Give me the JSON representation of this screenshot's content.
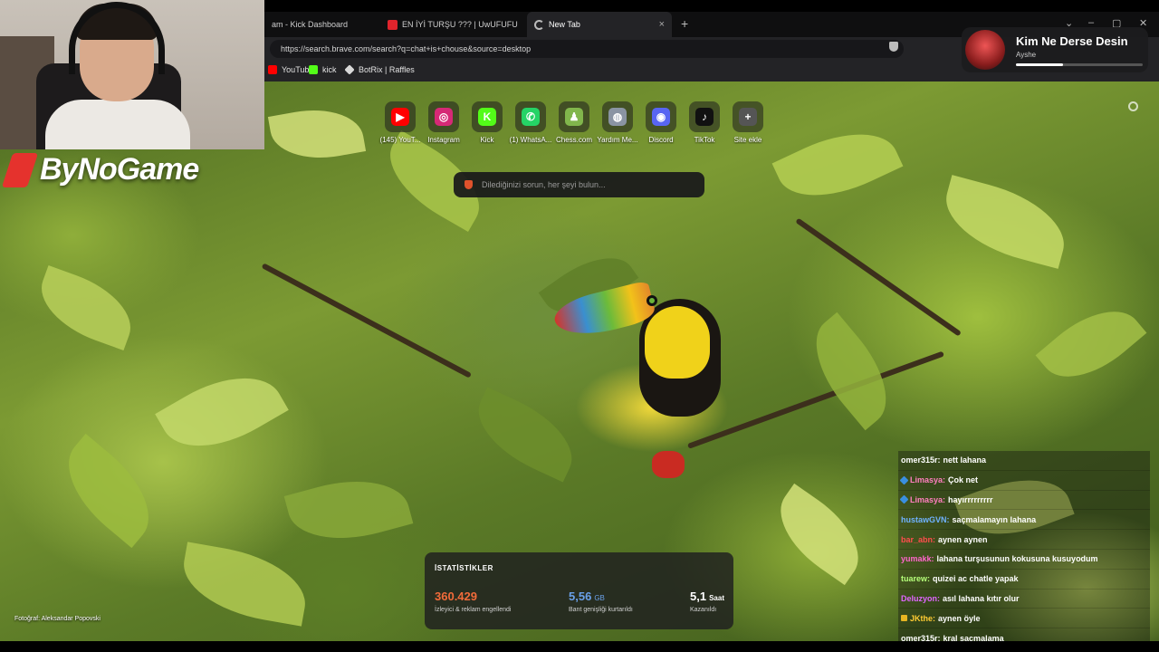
{
  "tabs": [
    {
      "label": "am - Kick Dashboard",
      "favicon_color": "#53fc18"
    },
    {
      "label": "EN İYİ TURŞU ??? | UwUFUFU",
      "favicon_color": "#e0242c"
    },
    {
      "label": "New Tab",
      "favicon_color": "#bbbbbb"
    }
  ],
  "tab_close_glyph": "×",
  "tab_add_glyph": "+",
  "address": {
    "url": "https://search.brave.com/search?q=chat+is+chouse&source=desktop"
  },
  "bookmarks": [
    {
      "label": "YouTube",
      "icon": "youtube-icon",
      "color": "#ff0000"
    },
    {
      "label": "kick",
      "icon": "kick-icon",
      "color": "#53fc18"
    },
    {
      "label": "BotRix | Raffles",
      "icon": "botrix-icon",
      "color": "#d8d8d8"
    }
  ],
  "logo": {
    "text": "ByNoGame"
  },
  "shortcuts": [
    {
      "label": "(145) YouT...",
      "icon": "youtube-icon",
      "color": "#ff0000",
      "glyph": "▶"
    },
    {
      "label": "Instagram",
      "icon": "instagram-icon",
      "color": "#d62976",
      "glyph": "◎"
    },
    {
      "label": "Kick",
      "icon": "kick-icon",
      "color": "#53fc18",
      "glyph": "K"
    },
    {
      "label": "(1) WhatsA...",
      "icon": "whatsapp-icon",
      "color": "#25d366",
      "glyph": "✆"
    },
    {
      "label": "Chess.com",
      "icon": "chess-icon",
      "color": "#81b64c",
      "glyph": "♟"
    },
    {
      "label": "Yardım Me...",
      "icon": "globe-icon",
      "color": "#8a94a3",
      "glyph": "◍"
    },
    {
      "label": "Discord",
      "icon": "discord-icon",
      "color": "#5865f2",
      "glyph": "◉"
    },
    {
      "label": "TikTok",
      "icon": "tiktok-icon",
      "color": "#111111",
      "glyph": "♪"
    },
    {
      "label": "Site ekle",
      "icon": "add-icon",
      "color": "#555555",
      "glyph": "+"
    }
  ],
  "search": {
    "placeholder": "Dilediğinizi sorun, her şeyi bulun..."
  },
  "stats": {
    "title": "İSTATİSTİKLER",
    "items": [
      {
        "value": "360.429",
        "unit": "",
        "label": "İzleyici & reklam engellendi",
        "color": "#f26b3a"
      },
      {
        "value": "5,56",
        "unit": "GB",
        "label": "Bant genişliği kurtarıldı",
        "color": "#6aa0e8"
      },
      {
        "value": "5,1",
        "unit": "Saat",
        "label": "Kazanıldı",
        "color": "#ffffff"
      }
    ]
  },
  "photo_credit": "Fotoğraf: Aleksandar Popovski",
  "now_playing": {
    "title": "Kim Ne Derse Desin",
    "artist": "Ayshe",
    "progress": 0.37
  },
  "chat": [
    {
      "user": "omer315r:",
      "msg": "nett lahana",
      "color": "#ffffff",
      "badge": ""
    },
    {
      "user": "Limasya:",
      "msg": "Çok net",
      "color": "#ff7fbf",
      "badge": "blue"
    },
    {
      "user": "Limasya:",
      "msg": "hayırrrrrrrrr",
      "color": "#ff7fbf",
      "badge": "blue"
    },
    {
      "user": "hustawGVN:",
      "msg": "saçmalamayın lahana",
      "color": "#6fb2ff",
      "badge": ""
    },
    {
      "user": "bar_abn:",
      "msg": "aynen aynen",
      "color": "#ff4d4d",
      "badge": ""
    },
    {
      "user": "yumakk:",
      "msg": "lahana turşusunun kokusuna kusuyodum",
      "color": "#ff66cc",
      "badge": ""
    },
    {
      "user": "tuarew:",
      "msg": "quizei ac chatle yapak",
      "color": "#b6ff7a",
      "badge": ""
    },
    {
      "user": "Deluzyon:",
      "msg": "asıl lahana kıtır olur",
      "color": "#e066ff",
      "badge": ""
    },
    {
      "user": "JKthe:",
      "msg": "aynen öyle",
      "color": "#ffcc33",
      "badge": "gold"
    },
    {
      "user": "omer315r:",
      "msg": "kral saçmalama",
      "color": "#ffffff",
      "badge": ""
    }
  ]
}
